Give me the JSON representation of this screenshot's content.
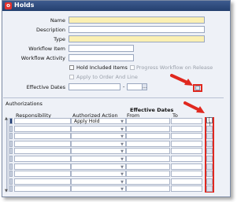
{
  "window": {
    "title": "Holds",
    "title_icon": "oracle-form-icon"
  },
  "header": {
    "name_label": "Name",
    "description_label": "Description",
    "type_label": "Type",
    "workflow_item_label": "Workflow Item",
    "workflow_activity_label": "Workflow Activity",
    "hold_included_items_label": "Hold Included Items",
    "progress_workflow_label": "Progress Workflow on Release",
    "apply_to_order_label": "Apply to Order And Line",
    "effective_dates_label": "Effective Dates",
    "effective_from_value": "",
    "effective_to_value": "",
    "date_separator": "-",
    "lov_button": "..."
  },
  "authorizations": {
    "section_label": "Authorizations",
    "group_header": "Effective Dates",
    "columns": {
      "responsibility": "Responsibility",
      "authorized_action": "Authorized Action",
      "from": "From",
      "to": "To",
      "dff": "[ ]"
    },
    "rows": [
      {
        "responsibility": "",
        "action": "Apply Hold",
        "from": "",
        "to": ""
      },
      {
        "responsibility": "",
        "action": "",
        "from": "",
        "to": ""
      },
      {
        "responsibility": "",
        "action": "",
        "from": "",
        "to": ""
      },
      {
        "responsibility": "",
        "action": "",
        "from": "",
        "to": ""
      },
      {
        "responsibility": "",
        "action": "",
        "from": "",
        "to": ""
      },
      {
        "responsibility": "",
        "action": "",
        "from": "",
        "to": ""
      },
      {
        "responsibility": "",
        "action": "",
        "from": "",
        "to": ""
      },
      {
        "responsibility": "",
        "action": "",
        "from": "",
        "to": ""
      },
      {
        "responsibility": "",
        "action": "",
        "from": "",
        "to": ""
      },
      {
        "responsibility": "",
        "action": "",
        "from": "",
        "to": ""
      }
    ]
  },
  "colors": {
    "required_field": "#fbf0b2",
    "highlight": "#e0281f",
    "titlebar": "#24406f"
  }
}
